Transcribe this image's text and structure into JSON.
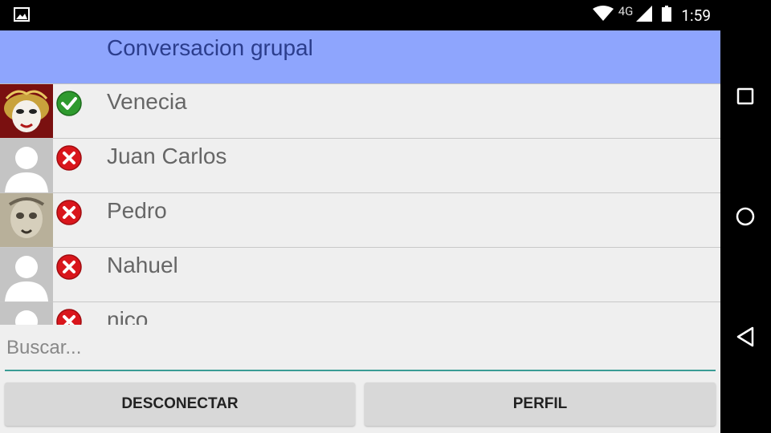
{
  "status_bar": {
    "network": "4G",
    "time": "1:59"
  },
  "header": {
    "title": "Conversacion grupal"
  },
  "contacts": [
    {
      "name": "Venecia",
      "status": "online",
      "avatar": "venetian-mask"
    },
    {
      "name": "Juan Carlos",
      "status": "offline",
      "avatar": "default-person"
    },
    {
      "name": "Pedro",
      "status": "offline",
      "avatar": "face-sketch"
    },
    {
      "name": "Nahuel",
      "status": "offline",
      "avatar": "default-person"
    },
    {
      "name": "nico",
      "status": "offline",
      "avatar": "default-person"
    }
  ],
  "search": {
    "placeholder": "Buscar..."
  },
  "buttons": {
    "disconnect": "DESCONECTAR",
    "profile": "PERFIL"
  },
  "colors": {
    "header_bg": "#8ea5fd",
    "accent_underline": "#3a9c95",
    "online": "#2e9a2e",
    "offline": "#d9161c"
  }
}
